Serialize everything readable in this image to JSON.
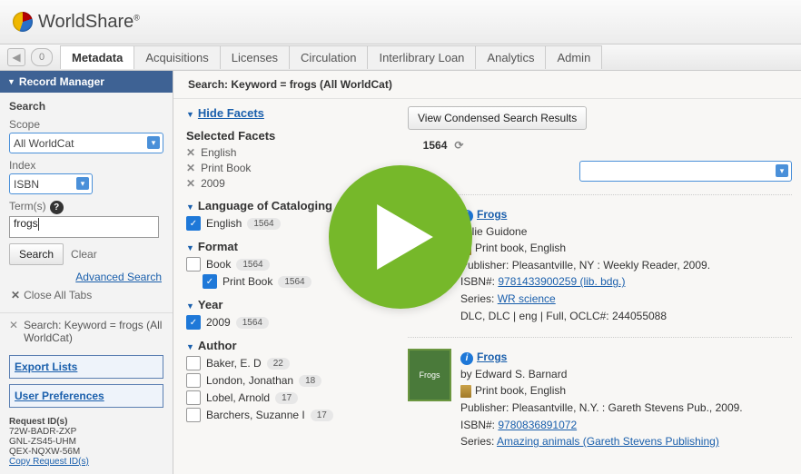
{
  "brand": {
    "name": "WorldShare",
    "reg": "®"
  },
  "nav": {
    "back_count": "0",
    "tabs": [
      {
        "label": "Metadata",
        "active": true
      },
      {
        "label": "Acquisitions"
      },
      {
        "label": "Licenses"
      },
      {
        "label": "Circulation"
      },
      {
        "label": "Interlibrary Loan"
      },
      {
        "label": "Analytics"
      },
      {
        "label": "Admin"
      }
    ]
  },
  "sidebar": {
    "manager_title": "Record Manager",
    "search_label": "Search",
    "scope_label": "Scope",
    "scope_value": "All WorldCat",
    "index_label": "Index",
    "index_value": "ISBN",
    "terms_label": "Term(s)",
    "terms_value": "frogs",
    "search_btn": "Search",
    "clear_btn": "Clear",
    "advanced": "Advanced Search",
    "close_all": "Close All Tabs",
    "history": "Search: Keyword = frogs (All WorldCat)",
    "export": "Export Lists",
    "prefs": "User Preferences",
    "req_title": "Request ID(s)",
    "req_ids": [
      "72W-BADR-ZXP",
      "GNL-ZS45-UHM",
      "QEX-NQXW-56M"
    ],
    "copy_req": "Copy Request ID(s)"
  },
  "main": {
    "search_heading": "Search: Keyword = frogs (All WorldCat)",
    "hide_facets": "Hide Facets",
    "selected_facets_label": "Selected Facets",
    "selected_facets": [
      "English",
      "Print Book",
      "2009"
    ],
    "facet_groups": {
      "lang_title": "Language of Cataloging",
      "lang_item": "English",
      "lang_count": "1564",
      "format_title": "Format",
      "format_item1": "Book",
      "format_count1": "1564",
      "format_item2": "Print Book",
      "format_count2": "1564",
      "year_title": "Year",
      "year_item": "2009",
      "year_count": "1564",
      "author_title": "Author",
      "authors": [
        {
          "name": "Baker, E. D",
          "count": "22"
        },
        {
          "name": "London, Jonathan",
          "count": "18"
        },
        {
          "name": "Lobel, Arnold",
          "count": "17"
        },
        {
          "name": "Barchers, Suzanne I",
          "count": "17"
        }
      ]
    },
    "view_condensed": "View Condensed Search Results",
    "result_count_suffix": "1564",
    "records": [
      {
        "title": "Frogs",
        "author": "Julie Guidone",
        "format": "Print book, English",
        "publisher": "Publisher: Pleasantville, NY : Weekly Reader, 2009.",
        "isbn_label": "ISBN#:",
        "isbn": "9781433900259 (lib. bdg.)",
        "series_label": "Series:",
        "series": "WR science",
        "catline": "DLC, DLC | eng | Full, OCLC#: 244055088"
      },
      {
        "title": "Frogs",
        "byline": "by Edward S. Barnard",
        "format": "Print book, English",
        "publisher": "Publisher: Pleasantville, N.Y. : Gareth Stevens Pub., 2009.",
        "isbn_label": "ISBN#:",
        "isbn": "9780836891072",
        "series_label": "Series:",
        "series": "Amazing animals (Gareth Stevens Publishing)"
      }
    ]
  }
}
